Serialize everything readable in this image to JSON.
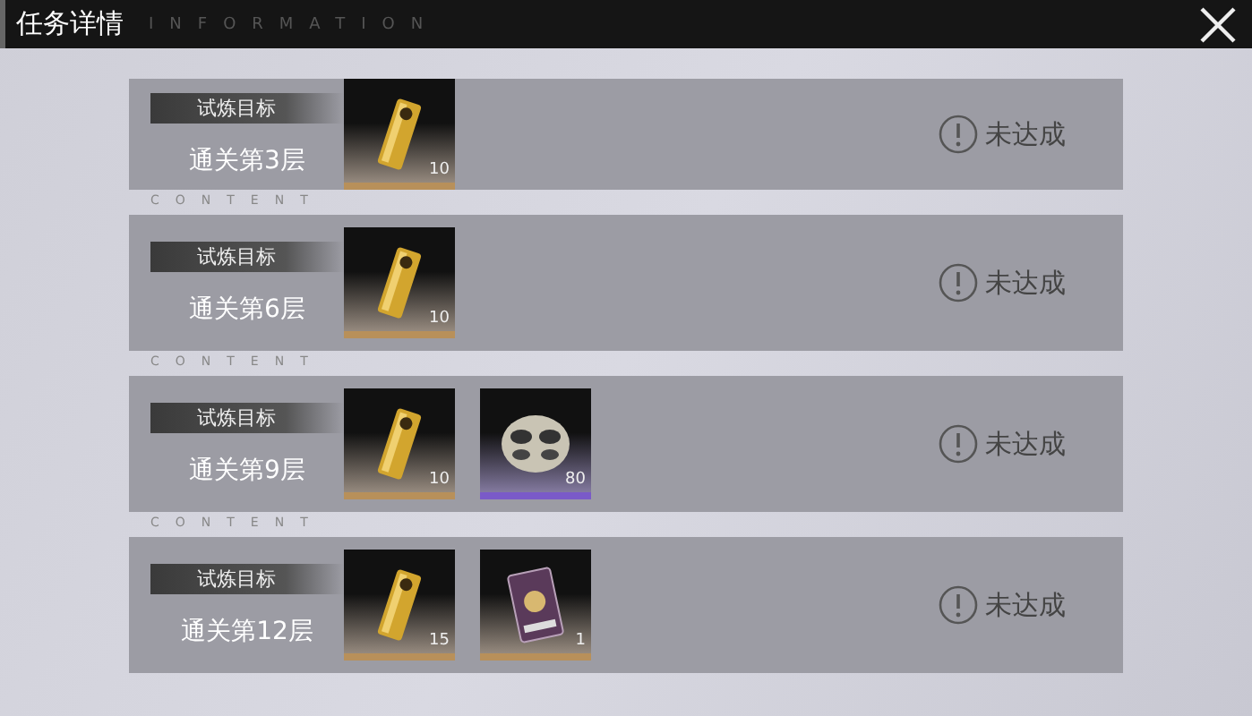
{
  "window": {
    "title": "任务详情",
    "subtitle": "INFORMATION"
  },
  "tasks": [
    {
      "tag": "试炼目标",
      "goal": "通关第3层",
      "rewards": [
        {
          "kind": "ingot",
          "count": "10",
          "color": "#b8905a"
        }
      ],
      "status": "未达成"
    },
    {
      "section_label": "CONTENT",
      "tag": "试炼目标",
      "goal": "通关第6层",
      "rewards": [
        {
          "kind": "ingot",
          "count": "10",
          "color": "#b8905a"
        }
      ],
      "status": "未达成"
    },
    {
      "section_label": "CONTENT",
      "tag": "试炼目标",
      "goal": "通关第9层",
      "rewards": [
        {
          "kind": "ingot",
          "count": "10",
          "color": "#b8905a"
        },
        {
          "kind": "ring",
          "count": "80",
          "color": "#7a5ac8"
        }
      ],
      "status": "未达成"
    },
    {
      "section_label": "CONTENT",
      "tag": "试炼目标",
      "goal": "通关第12层",
      "rewards": [
        {
          "kind": "ingot",
          "count": "15",
          "color": "#b8905a"
        },
        {
          "kind": "card",
          "count": "1",
          "color": "#b8905a"
        }
      ],
      "status": "未达成"
    }
  ]
}
